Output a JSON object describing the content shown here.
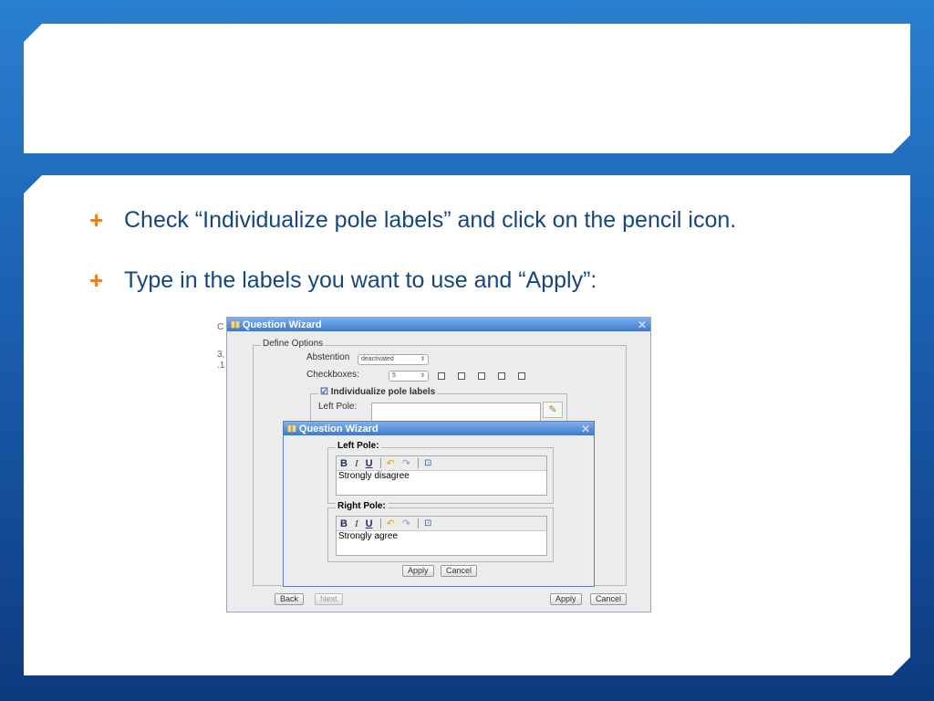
{
  "slide": {
    "bullets": [
      "Check “Individualize pole labels” and click on the pencil icon.",
      "Type in the labels you want to use and “Apply”:"
    ]
  },
  "dialog1": {
    "title": "Question Wizard",
    "fieldset": "Define Options",
    "abstention_label": "Abstention",
    "abstention_value": "deactivated",
    "checkboxes_label": "Checkboxes:",
    "checkboxes_value": "5",
    "individualize_label": "Individualize pole labels",
    "left_pole_label": "Left Pole:",
    "back": "Back",
    "next": "Next",
    "apply": "Apply",
    "cancel": "Cancel"
  },
  "dialog2": {
    "title": "Question Wizard",
    "left_pole_legend": "Left Pole:",
    "left_pole_text": "Strongly disagree",
    "right_pole_legend": "Right Pole:",
    "right_pole_text": "Strongly agree",
    "apply": "Apply",
    "cancel": "Cancel",
    "toolbar": {
      "bold": "B",
      "italic": "I",
      "underline": "U"
    }
  },
  "background_fragments": [
    "C",
    "3,",
    ".1"
  ],
  "colors": {
    "bullet_text": "#16467f",
    "bullet_marker": "#f07c1b",
    "title_bar": "#3f79cc"
  }
}
